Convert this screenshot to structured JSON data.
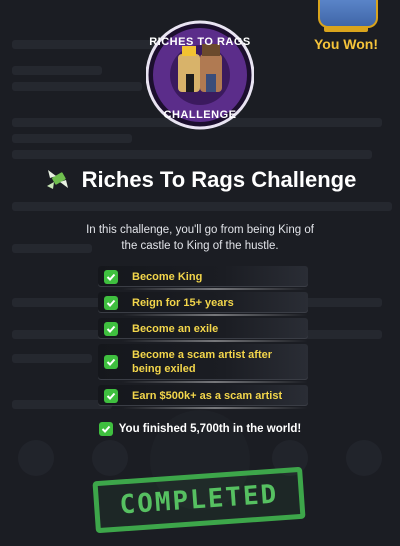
{
  "header": {
    "you_won": "You Won!"
  },
  "badge": {
    "top_text": "RICHES TO RAGS",
    "bottom_text": "CHALLENGE"
  },
  "challenge": {
    "title": "Riches To Rags Challenge",
    "description": "In this challenge, you'll go from being King of the castle to King of the hustle.",
    "requirements": [
      "Become King",
      "Reign for 15+ years",
      "Become an exile",
      "Become a scam artist after being exiled",
      "Earn $500k+ as a scam artist"
    ],
    "result": "You finished 5,700th in the world!",
    "stamp": "COMPLETED"
  },
  "colors": {
    "accent_yellow": "#f3d64b",
    "check_green": "#3fbf3f",
    "stamp_green": "#3da64a",
    "badge_purple": "#5b2d8a"
  }
}
